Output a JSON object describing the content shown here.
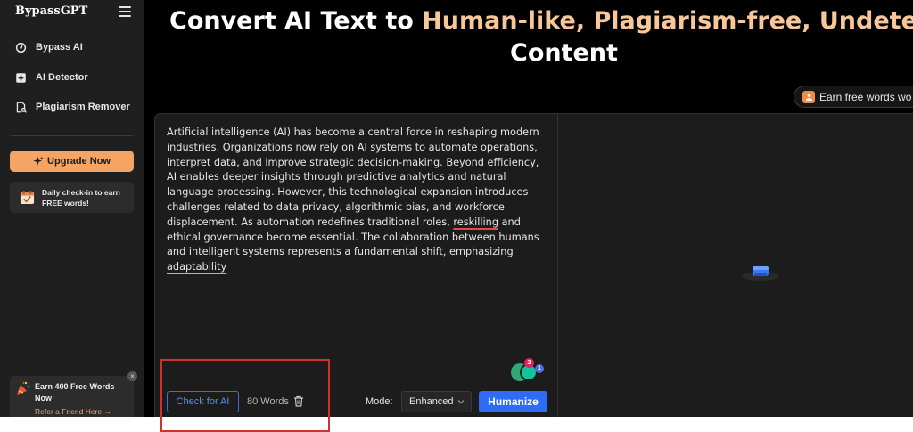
{
  "sidebar": {
    "brand": "BypassGPT",
    "nav": [
      {
        "label": "Bypass AI",
        "icon": "refresh-icon"
      },
      {
        "label": "AI Detector",
        "icon": "plus-square-icon"
      },
      {
        "label": "Plagiarism Remover",
        "icon": "document-search-icon"
      }
    ],
    "upgrade_label": "Upgrade Now",
    "checkin_line1": "Daily check-in to earn",
    "checkin_line2": "FREE words!",
    "referral_title": "Earn 400 Free Words Now",
    "referral_link": "Refer a Friend Here →",
    "referral_close": "×"
  },
  "header": {
    "title_prefix": "Convert AI Text to ",
    "title_highlight": "Human-like, Plagiarism-free, Undetectab",
    "title_line2": "Content",
    "earn_pill": "Earn free words wo"
  },
  "editor": {
    "text_before_1": "Artificial intelligence (AI) has become a central force in reshaping modern industries. Organizations now rely on AI systems to automate operations, interpret data, and improve strategic decision-making. Beyond efficiency, AI enables deeper insights through predictive analytics and natural language processing. However, this technological expansion introduces challenges related to data privacy, algorithmic bias, and workforce displacement. As automation redefines traditional roles, ",
    "flag_1": "reskilling",
    "text_before_2": " and ethical governance become essential. The collaboration between humans and intelligent systems represents a fundamental shift, emphasizing ",
    "flag_2": "adaptability",
    "check_ai_label": "Check for AI",
    "word_count": "80 Words",
    "mode_label": "Mode:",
    "mode_value": "Enhanced",
    "humanize_label": "Humanize",
    "grammar_count_1": "2",
    "grammar_count_2": "1"
  },
  "colors": {
    "accent_orange": "#f5a463",
    "highlight_peach": "#f7c79a",
    "primary_blue": "#2e6cf6",
    "annotation_red": "#d0312d"
  }
}
